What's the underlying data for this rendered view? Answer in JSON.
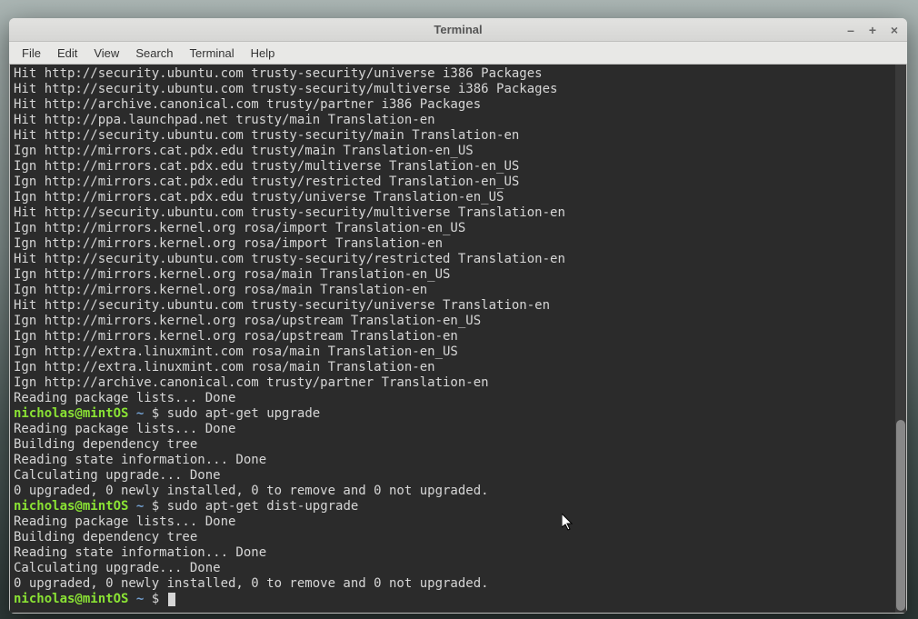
{
  "window": {
    "title": "Terminal"
  },
  "menu": {
    "file": "File",
    "edit": "Edit",
    "view": "View",
    "search": "Search",
    "terminal": "Terminal",
    "help": "Help"
  },
  "prompt": {
    "userhost": "nicholas@mintOS",
    "path": "~",
    "sigil": "$"
  },
  "commands": {
    "upgrade": "sudo apt-get upgrade",
    "dist_upgrade": "sudo apt-get dist-upgrade"
  },
  "lines": {
    "l01": "Hit http://security.ubuntu.com trusty-security/universe i386 Packages",
    "l02": "Hit http://security.ubuntu.com trusty-security/multiverse i386 Packages",
    "l03": "Hit http://archive.canonical.com trusty/partner i386 Packages",
    "l04": "Hit http://ppa.launchpad.net trusty/main Translation-en",
    "l05": "Hit http://security.ubuntu.com trusty-security/main Translation-en",
    "l06": "Ign http://mirrors.cat.pdx.edu trusty/main Translation-en_US",
    "l07": "Ign http://mirrors.cat.pdx.edu trusty/multiverse Translation-en_US",
    "l08": "Ign http://mirrors.cat.pdx.edu trusty/restricted Translation-en_US",
    "l09": "Ign http://mirrors.cat.pdx.edu trusty/universe Translation-en_US",
    "l10": "Hit http://security.ubuntu.com trusty-security/multiverse Translation-en",
    "l11": "Ign http://mirrors.kernel.org rosa/import Translation-en_US",
    "l12": "Ign http://mirrors.kernel.org rosa/import Translation-en",
    "l13": "Hit http://security.ubuntu.com trusty-security/restricted Translation-en",
    "l14": "Ign http://mirrors.kernel.org rosa/main Translation-en_US",
    "l15": "Ign http://mirrors.kernel.org rosa/main Translation-en",
    "l16": "Hit http://security.ubuntu.com trusty-security/universe Translation-en",
    "l17": "Ign http://mirrors.kernel.org rosa/upstream Translation-en_US",
    "l18": "Ign http://mirrors.kernel.org rosa/upstream Translation-en",
    "l19": "Ign http://extra.linuxmint.com rosa/main Translation-en_US",
    "l20": "Ign http://extra.linuxmint.com rosa/main Translation-en",
    "l21": "Ign http://archive.canonical.com trusty/partner Translation-en",
    "l22": "Reading package lists... Done",
    "l23": "Reading package lists... Done",
    "l24": "Building dependency tree       ",
    "l25": "Reading state information... Done",
    "l26": "Calculating upgrade... Done",
    "l27": "0 upgraded, 0 newly installed, 0 to remove and 0 not upgraded.",
    "l28": "Reading package lists... Done",
    "l29": "Building dependency tree       ",
    "l30": "Reading state information... Done",
    "l31": "Calculating upgrade... Done",
    "l32": "0 upgraded, 0 newly installed, 0 to remove and 0 not upgraded."
  }
}
